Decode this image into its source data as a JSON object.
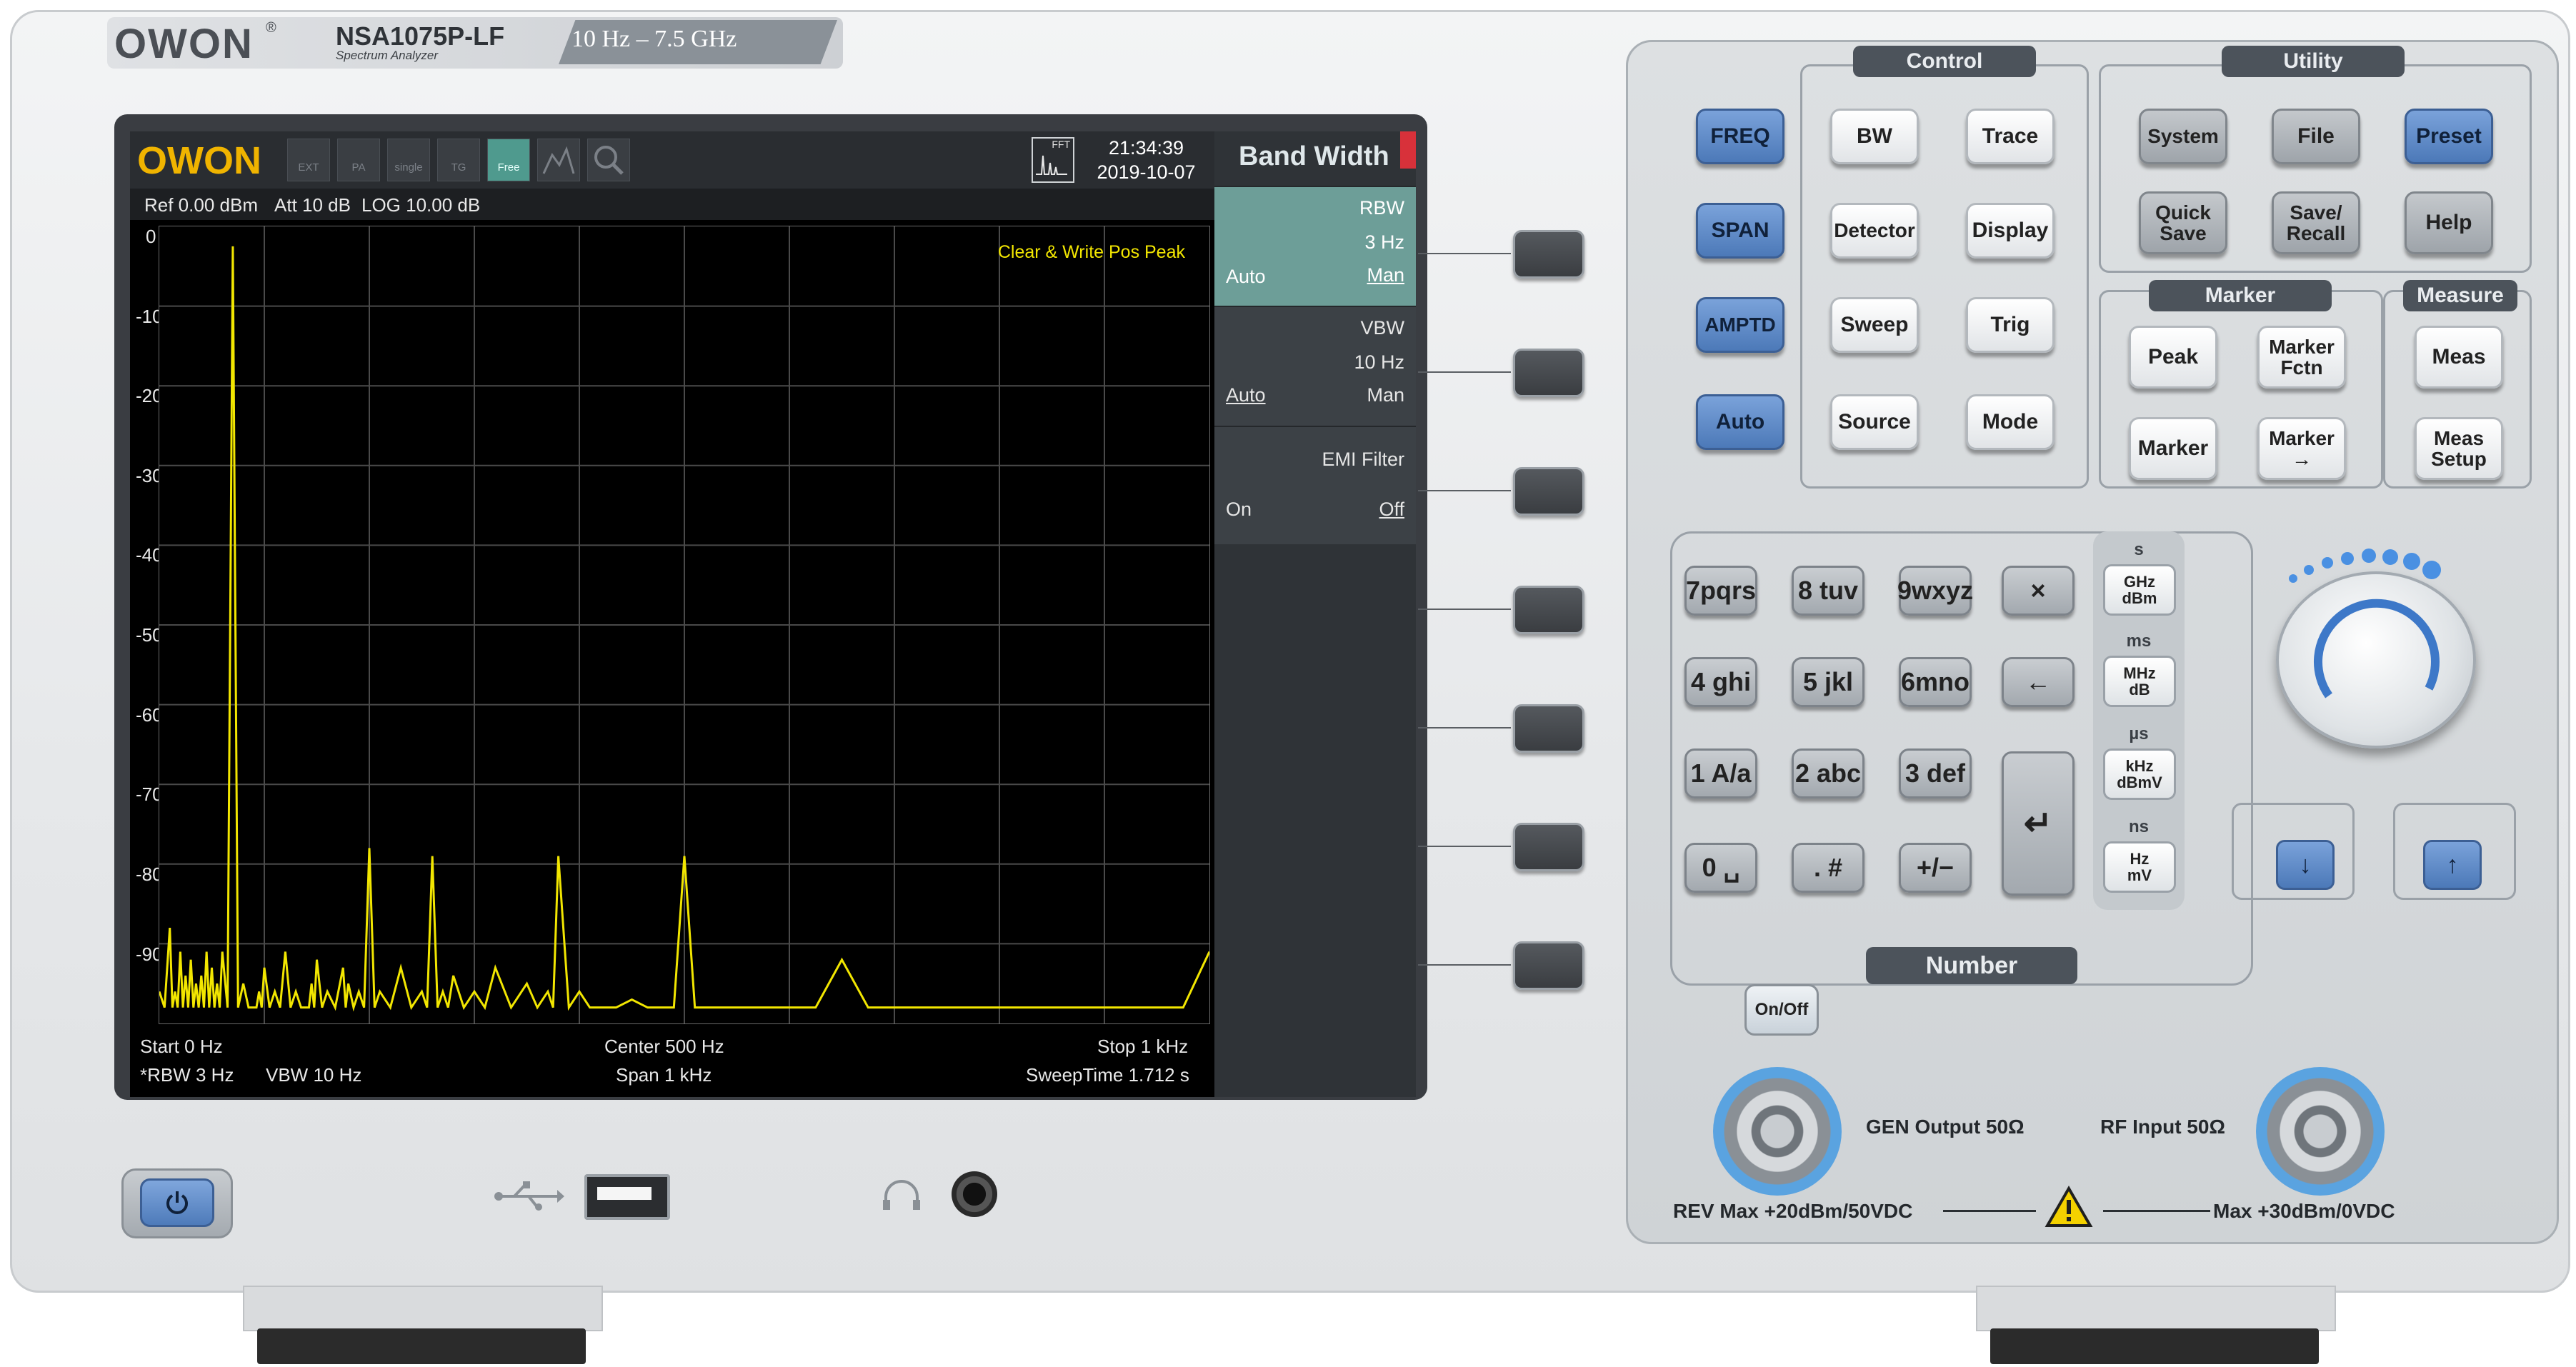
{
  "brand": {
    "logo": "OWON",
    "registered": "®",
    "model": "NSA1075P-LF",
    "subtitle": "Spectrum Analyzer",
    "range": "10 Hz – 7.5 GHz"
  },
  "screen": {
    "logo": "OWON",
    "status_icons": [
      {
        "label": "EXT",
        "icon": "ext-ref-icon",
        "active": false
      },
      {
        "label": "PA",
        "icon": "preamp-icon",
        "active": false
      },
      {
        "label": "single",
        "icon": "single-sweep-icon",
        "active": false
      },
      {
        "label": "TG",
        "icon": "tracking-generator-icon",
        "active": false
      },
      {
        "label": "Free",
        "icon": "trigger-free-icon",
        "active": true
      },
      {
        "label": "",
        "icon": "trace-icon",
        "active": false
      },
      {
        "label": "",
        "icon": "search-icon",
        "active": false
      }
    ],
    "fft_label": "FFT",
    "time": "21:34:39",
    "date": "2019-10-07",
    "info": {
      "ref": "Ref 0.00 dBm",
      "att": "Att 10 dB",
      "scale": "LOG 10.00 dB"
    },
    "trace_mode": "Clear & Write Pos Peak",
    "y_ticks": [
      "0",
      "-10",
      "-20",
      "-30",
      "-40",
      "-50",
      "-60",
      "-70",
      "-80",
      "-90"
    ],
    "bottom": {
      "start": "Start 0 Hz",
      "center": "Center 500 Hz",
      "stop": "Stop 1 kHz",
      "rbw": "*RBW 3 Hz",
      "vbw": "VBW 10 Hz",
      "span": "Span 1 kHz",
      "sweep": "SweepTime 1.712 s"
    },
    "menu": {
      "title": "Band Width",
      "rbw": {
        "label": "RBW",
        "value": "3 Hz",
        "left": "Auto",
        "right": "Man"
      },
      "vbw": {
        "label": "VBW",
        "value": "10 Hz",
        "left": "Auto",
        "right": "Man"
      },
      "emi": {
        "label": "EMI Filter",
        "left": "On",
        "right": "Off"
      }
    }
  },
  "chart_data": {
    "type": "line",
    "xlabel": "",
    "ylabel": "",
    "xlim": [
      0,
      1000
    ],
    "ylim": [
      -100,
      0
    ],
    "series": [
      {
        "x": [
          0,
          10,
          15,
          20,
          25,
          30,
          35,
          40,
          45,
          50,
          55,
          60,
          70,
          80,
          90,
          95,
          100,
          110,
          120,
          130,
          140,
          145,
          150,
          160,
          175,
          180,
          190,
          200,
          210,
          230,
          250,
          260,
          270,
          280,
          300,
          320,
          350,
          370,
          380,
          400,
          420,
          450,
          480,
          500,
          520,
          550,
          600,
          650,
          700,
          750,
          800,
          850,
          900,
          950,
          1000
        ],
        "y": [
          -96,
          -88,
          -96,
          -91,
          -94,
          -92,
          -95,
          -94,
          -91,
          -93,
          -95,
          -91,
          -2.5,
          -95,
          -98,
          -96,
          -93,
          -96,
          -91,
          -96,
          -98,
          -95,
          -92,
          -96,
          -93,
          -95,
          -96,
          -78,
          -96,
          -93,
          -96,
          -79,
          -96,
          -94,
          -96,
          -93,
          -95,
          -96,
          -79,
          -96,
          -98,
          -97,
          -98,
          -79,
          -98,
          -98,
          -98,
          -92,
          -98,
          -98,
          -98,
          -98,
          -98,
          -98,
          -91
        ]
      }
    ]
  },
  "control": {
    "title": "Control",
    "keys": [
      "BW",
      "Trace",
      "Detector",
      "Display",
      "Sweep",
      "Trig",
      "Source",
      "Mode"
    ]
  },
  "left_keys": [
    "FREQ",
    "SPAN",
    "AMPTD",
    "Auto"
  ],
  "utility": {
    "title": "Utility",
    "keys": [
      "System",
      "File",
      "Preset",
      "Quick\nSave",
      "Save/\nRecall",
      "Help"
    ]
  },
  "marker": {
    "title": "Marker",
    "keys": [
      "Peak",
      "Marker\nFctn",
      "Marker",
      "Marker\n→"
    ]
  },
  "measure": {
    "title": "Measure",
    "keys": [
      "Meas",
      "Meas\nSetup"
    ]
  },
  "number": {
    "title": "Number",
    "keys": [
      "7pqrs",
      "8 tuv",
      "9wxyz",
      "×",
      "4 ghi",
      "5 jkl",
      "6mno",
      "←",
      "1 A/a",
      "2 abc",
      "3 def",
      "0 ␣",
      ". #",
      "+/−"
    ],
    "enter": "↵"
  },
  "units": [
    {
      "top": "s",
      "key": "GHz\ndBm"
    },
    {
      "top": "ms",
      "key": "MHz\ndB"
    },
    {
      "top": "µs",
      "key": "kHz\ndBmV"
    },
    {
      "top": "ns",
      "key": "Hz\nmV"
    }
  ],
  "onoff": "On/Off",
  "connectors": {
    "gen": "GEN Output 50Ω",
    "rf": "RF Input 50Ω",
    "rev": "REV Max +20dBm/50VDC",
    "max": "Max +30dBm/0VDC"
  },
  "colors": {
    "trace": "#f2e600",
    "key_blue": "#5f8ccc",
    "menu_selected": "#6d9e98"
  }
}
